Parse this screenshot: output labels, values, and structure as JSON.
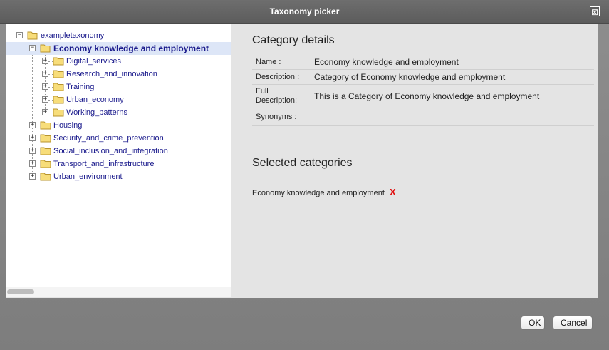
{
  "window": {
    "title": "Taxonomy picker",
    "close_label": "⊠"
  },
  "tree": {
    "root": "exampletaxonomy",
    "items": [
      {
        "label": "Economy knowledge and employment",
        "level": 1,
        "expander": "−",
        "selected": true
      },
      {
        "label": "Digital_services",
        "level": 2,
        "expander": "+"
      },
      {
        "label": "Research_and_innovation",
        "level": 2,
        "expander": "+"
      },
      {
        "label": "Training",
        "level": 2,
        "expander": "+"
      },
      {
        "label": "Urban_economy",
        "level": 2,
        "expander": "+"
      },
      {
        "label": "Working_patterns",
        "level": 2,
        "expander": "+"
      },
      {
        "label": "Housing",
        "level": 1,
        "expander": "+"
      },
      {
        "label": "Security_and_crime_prevention",
        "level": 1,
        "expander": "+"
      },
      {
        "label": "Social_inclusion_and_integration",
        "level": 1,
        "expander": "+"
      },
      {
        "label": "Transport_and_infrastructure",
        "level": 1,
        "expander": "+"
      },
      {
        "label": "Urban_environment",
        "level": 1,
        "expander": "+"
      }
    ]
  },
  "details": {
    "heading": "Category details",
    "name_key": "Name :",
    "name_value": "Economy knowledge and employment",
    "description_key": "Description :",
    "description_value": "Category of Economy knowledge and employment",
    "full_description_key_1": "Full",
    "full_description_key_2": "Description:",
    "full_description_value": "This is a Category of Economy knowledge and employment",
    "synonyms_key": "Synonyms :",
    "synonyms_value": ""
  },
  "selected": {
    "heading": "Selected categories",
    "items": [
      "Economy knowledge and employment"
    ],
    "remove_label": "X"
  },
  "buttons": {
    "ok": "OK",
    "cancel": "Cancel"
  },
  "colors": {
    "link": "#1a1a8c",
    "remove": "#e01010",
    "selected_row": "#dde6f7"
  }
}
